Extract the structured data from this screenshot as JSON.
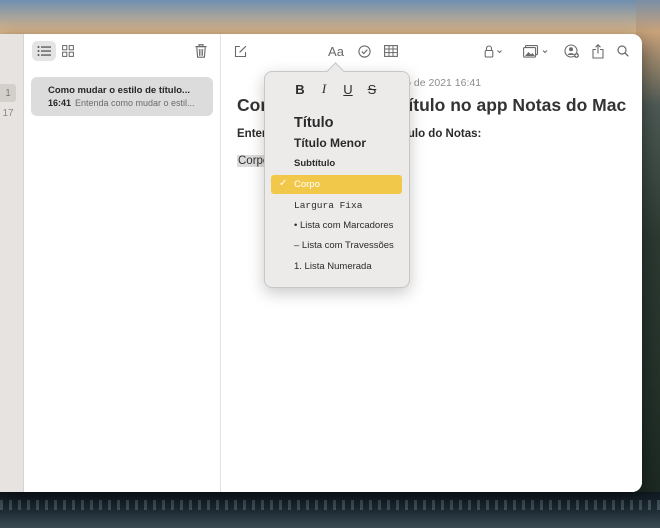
{
  "sidebar": {
    "counts": [
      "1",
      "17"
    ]
  },
  "note_list": {
    "items": [
      {
        "title": "Como mudar o estilo de título...",
        "time": "16:41",
        "snippet": "Entenda como mudar o estil..."
      }
    ]
  },
  "editor": {
    "date": "aio de 2021 16:41",
    "title_left": "Com",
    "title_right": "e título no app Notas do Mac",
    "heading_left": "Enter",
    "heading_right": "título do Notas:",
    "body": "Corpo",
    "format_button_label": "Aa"
  },
  "format_menu": {
    "bold": "B",
    "italic": "I",
    "underline": "U",
    "strikethrough": "S",
    "styles": [
      {
        "label": "Título"
      },
      {
        "label": "Título Menor"
      },
      {
        "label": "Subtítulo"
      },
      {
        "label": "Corpo"
      },
      {
        "label": "Largura Fixa"
      },
      {
        "label": "• Lista com Marcadores"
      },
      {
        "label": "– Lista com Travessões"
      },
      {
        "label": "1. Lista Numerada"
      }
    ],
    "selected_index": 3,
    "check_mark": "✓"
  },
  "colors": {
    "accent_yellow": "#f2c84b"
  },
  "icons": {
    "list_view": "list-view-icon",
    "gallery_view": "gallery-view-icon",
    "trash": "trash-icon",
    "compose": "compose-icon",
    "checklist": "checklist-icon",
    "table": "table-icon",
    "lock": "lock-icon",
    "media": "media-icon",
    "collaborate": "collaborate-icon",
    "share": "share-icon",
    "search": "search-icon"
  }
}
